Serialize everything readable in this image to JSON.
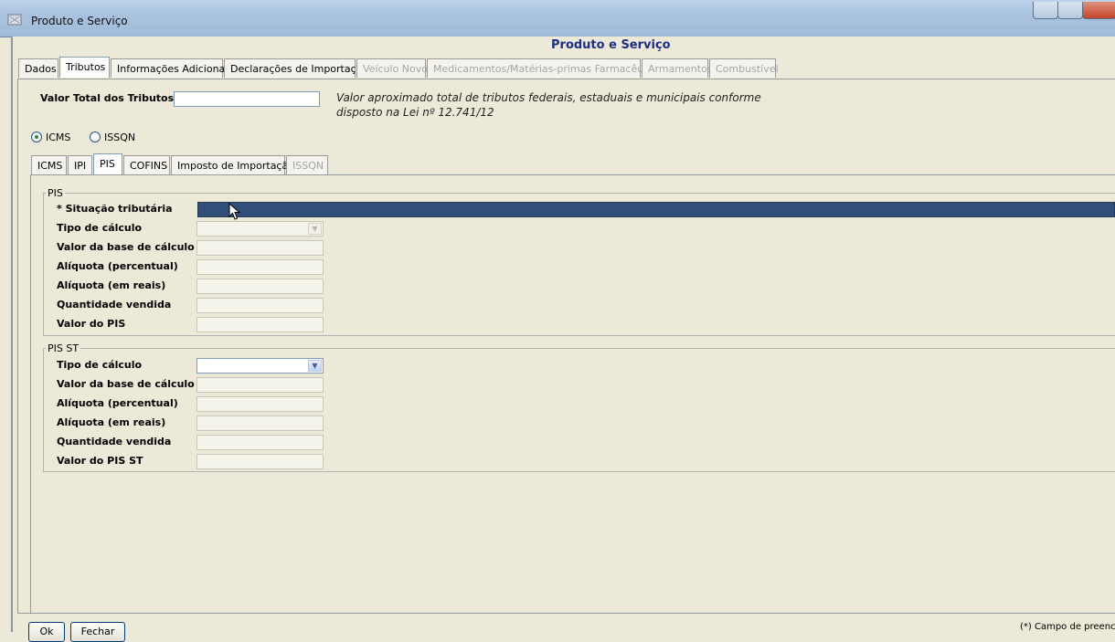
{
  "window": {
    "title": "Produto e Serviço",
    "icon": "app-icon"
  },
  "header": {
    "title": "Produto e Serviço"
  },
  "main_tabs": [
    {
      "label": "Dados",
      "state": "normal"
    },
    {
      "label": "Tributos",
      "state": "active"
    },
    {
      "label": "Informações Adicionais",
      "state": "normal"
    },
    {
      "label": "Declarações de Importação",
      "state": "normal"
    },
    {
      "label": "Veículo Novo",
      "state": "disabled"
    },
    {
      "label": "Medicamentos/Matérias-primas Farmacêuticas",
      "state": "disabled"
    },
    {
      "label": "Armamentos",
      "state": "disabled"
    },
    {
      "label": "Combustível",
      "state": "disabled"
    }
  ],
  "tributos": {
    "valor_total_label": "Valor Total dos Tributos",
    "valor_total_value": "",
    "note_line1": "Valor aproximado total de tributos federais, estaduais e municipais conforme",
    "note_line2": "disposto na Lei nº 12.741/12",
    "radio_icms": "ICMS",
    "radio_issqn": "ISSQN",
    "selected_radio": "ICMS"
  },
  "sub_tabs": [
    {
      "label": "ICMS",
      "state": "normal"
    },
    {
      "label": "IPI",
      "state": "normal"
    },
    {
      "label": "PIS",
      "state": "active"
    },
    {
      "label": "COFINS",
      "state": "normal"
    },
    {
      "label": "Imposto de Importação",
      "state": "normal"
    },
    {
      "label": "ISSQN",
      "state": "disabled"
    }
  ],
  "pis": {
    "group_title": "PIS",
    "situacao_label": "* Situação tributária",
    "tipo_calculo_label": "Tipo de cálculo",
    "base_calculo_label": "Valor da base de cálculo",
    "aliquota_percent_label": "Alíquota (percentual)",
    "aliquota_reais_label": "Alíquota (em reais)",
    "quantidade_label": "Quantidade vendida",
    "valor_label": "Valor do PIS"
  },
  "pis_st": {
    "group_title": "PIS ST",
    "tipo_calculo_label": "Tipo de cálculo",
    "base_calculo_label": "Valor da base de cálculo",
    "aliquota_percent_label": "Alíquota (percentual)",
    "aliquota_reais_label": "Alíquota (em reais)",
    "quantidade_label": "Quantidade vendida",
    "valor_label": "Valor do PIS ST"
  },
  "footer": {
    "ok_label": "Ok",
    "fechar_label": "Fechar",
    "note": "(*) Campo de preenc"
  },
  "colors": {
    "header_title": "#1c2e8a",
    "selection": "#2f4f7a"
  }
}
